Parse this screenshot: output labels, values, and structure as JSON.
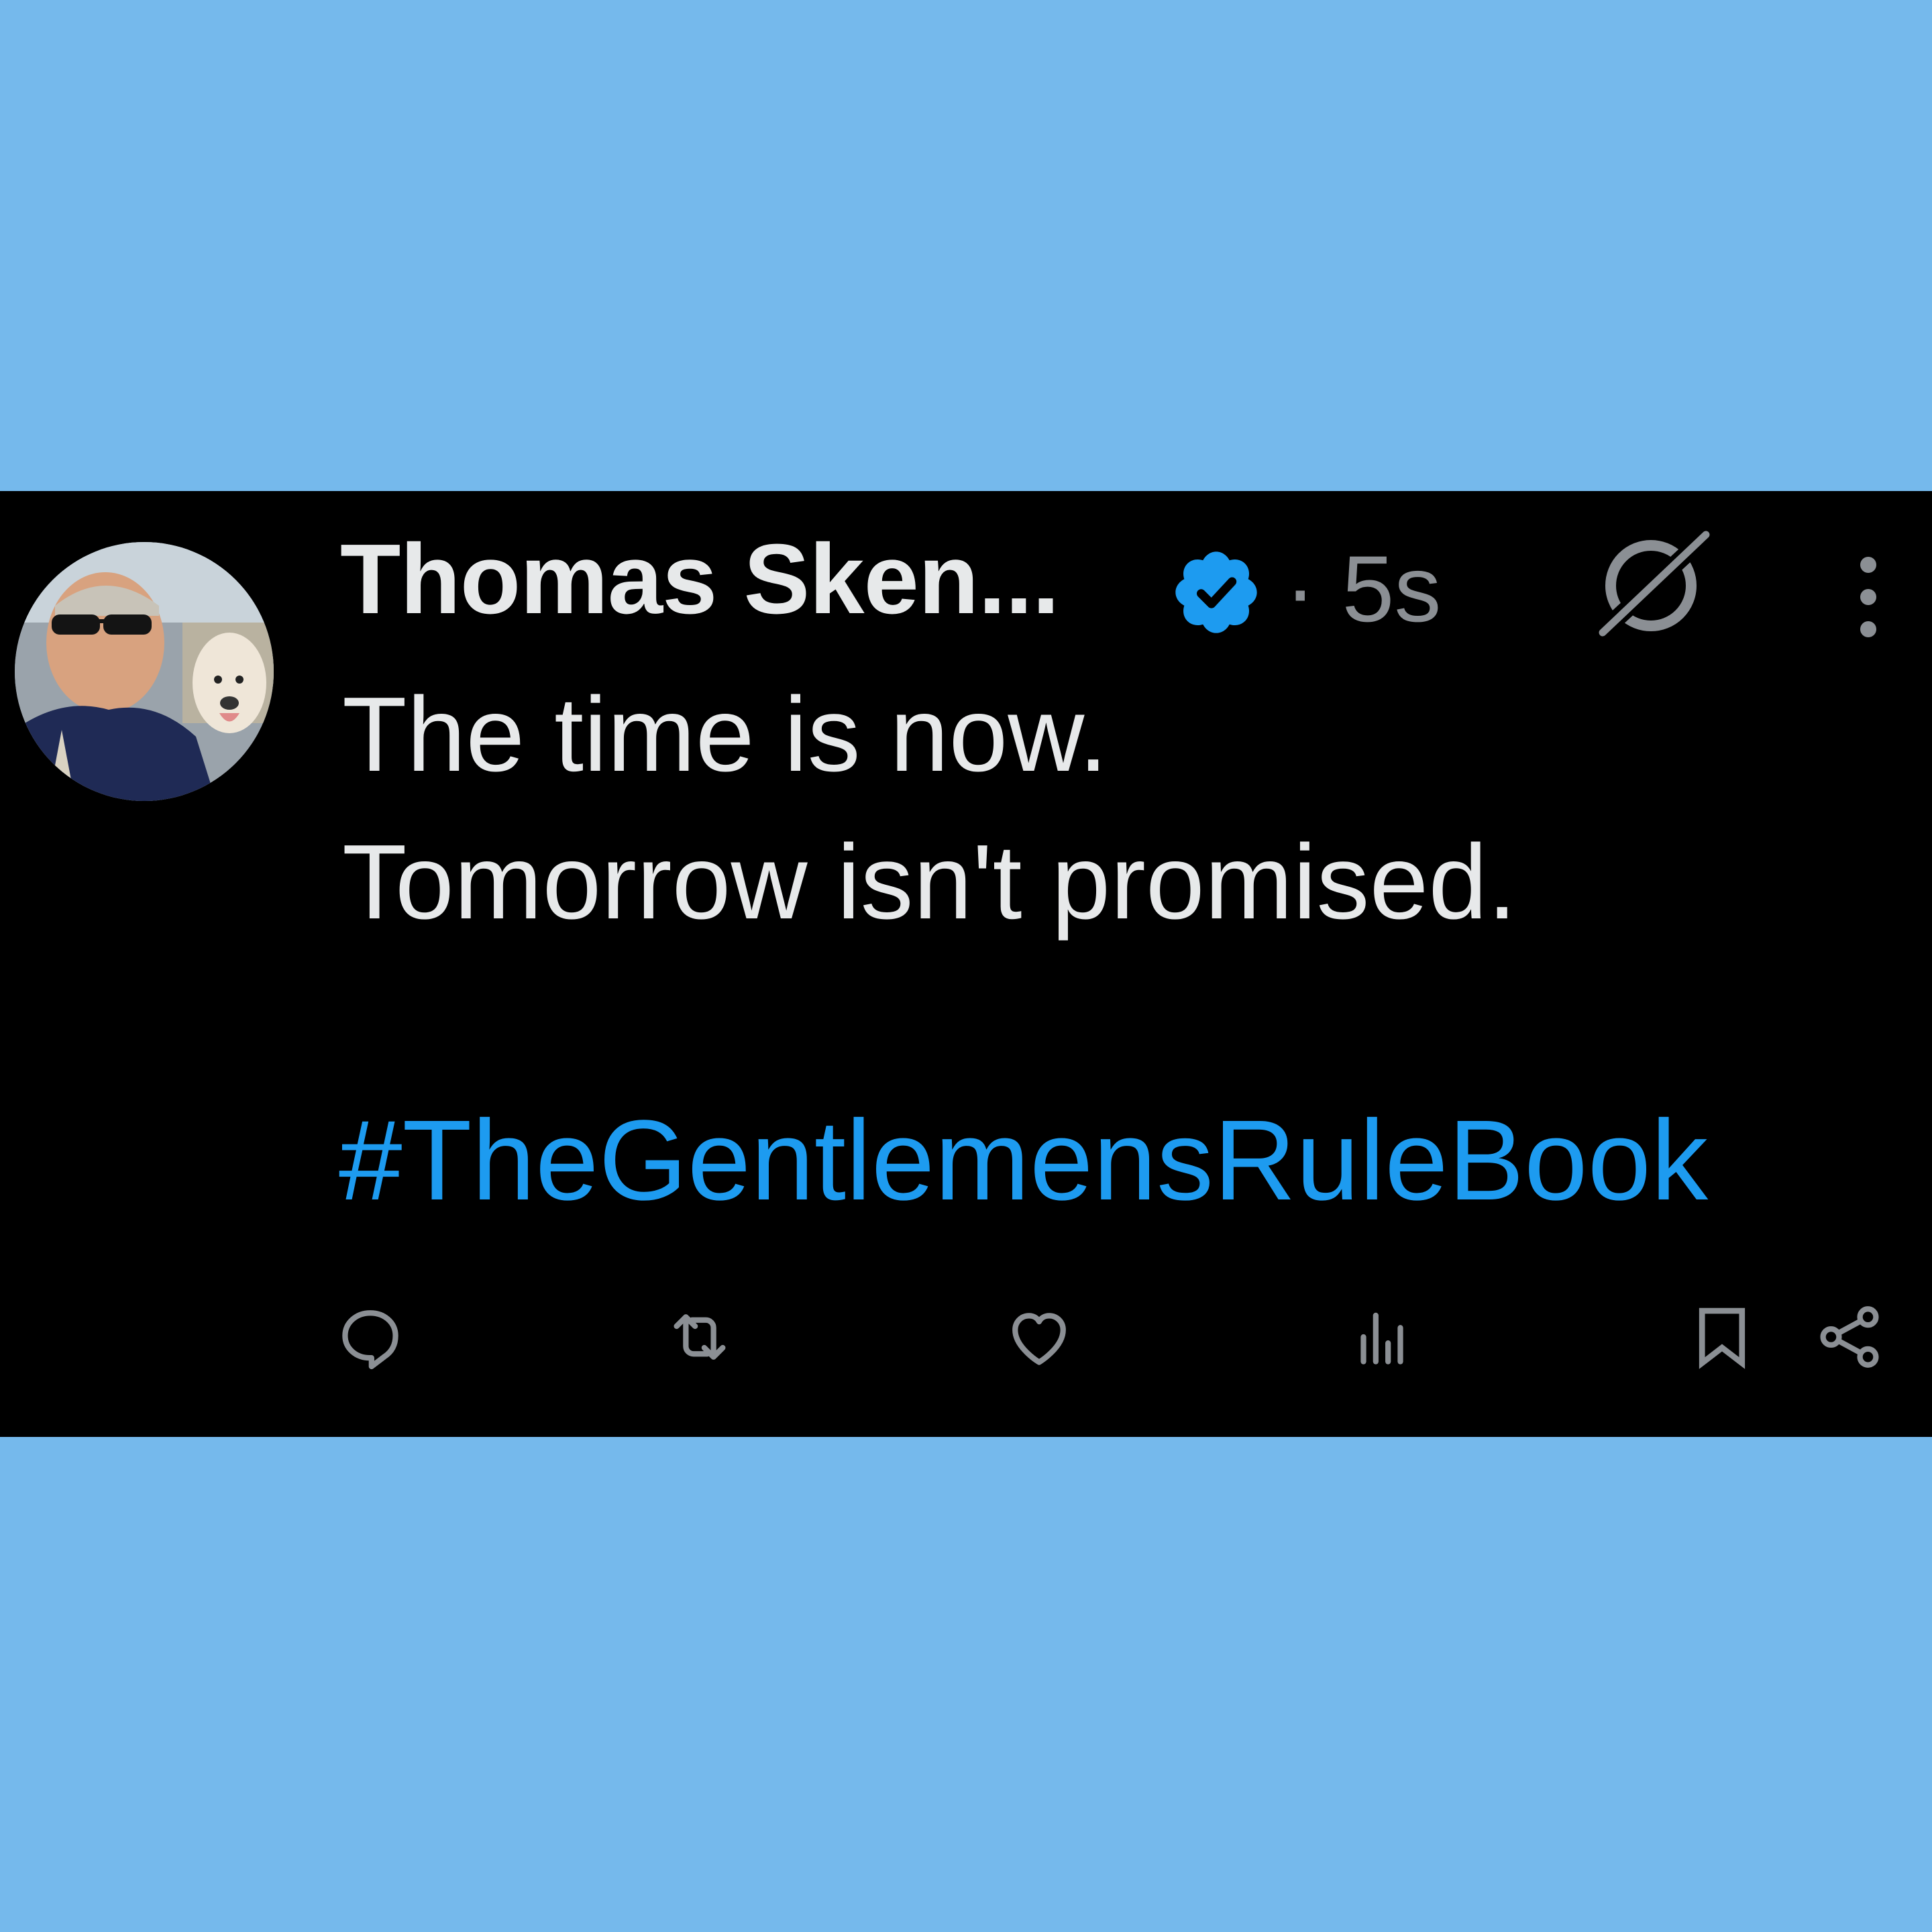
{
  "tweet": {
    "display_name": "Thomas Sken...",
    "timestamp": "· 5s",
    "lines": [
      "The time is now.",
      "Tomorrow isn't promised."
    ],
    "hashtag": "#TheGentlemensRuleBook",
    "icons": {
      "verified": "verified-badge-icon",
      "grok": "grok-icon",
      "more": "more-vertical-icon"
    }
  },
  "actions": [
    {
      "name": "reply",
      "icon": "reply-icon"
    },
    {
      "name": "repost",
      "icon": "repost-icon"
    },
    {
      "name": "like",
      "icon": "heart-icon"
    },
    {
      "name": "views",
      "icon": "views-icon"
    },
    {
      "name": "bookmark",
      "icon": "bookmark-icon"
    },
    {
      "name": "share",
      "icon": "share-icon"
    }
  ],
  "colors": {
    "page_background": "#75b9ec",
    "card_background": "#000000",
    "primary_text": "#e7e9ea",
    "secondary_text": "#8b8f94",
    "accent": "#1d9bf0"
  }
}
